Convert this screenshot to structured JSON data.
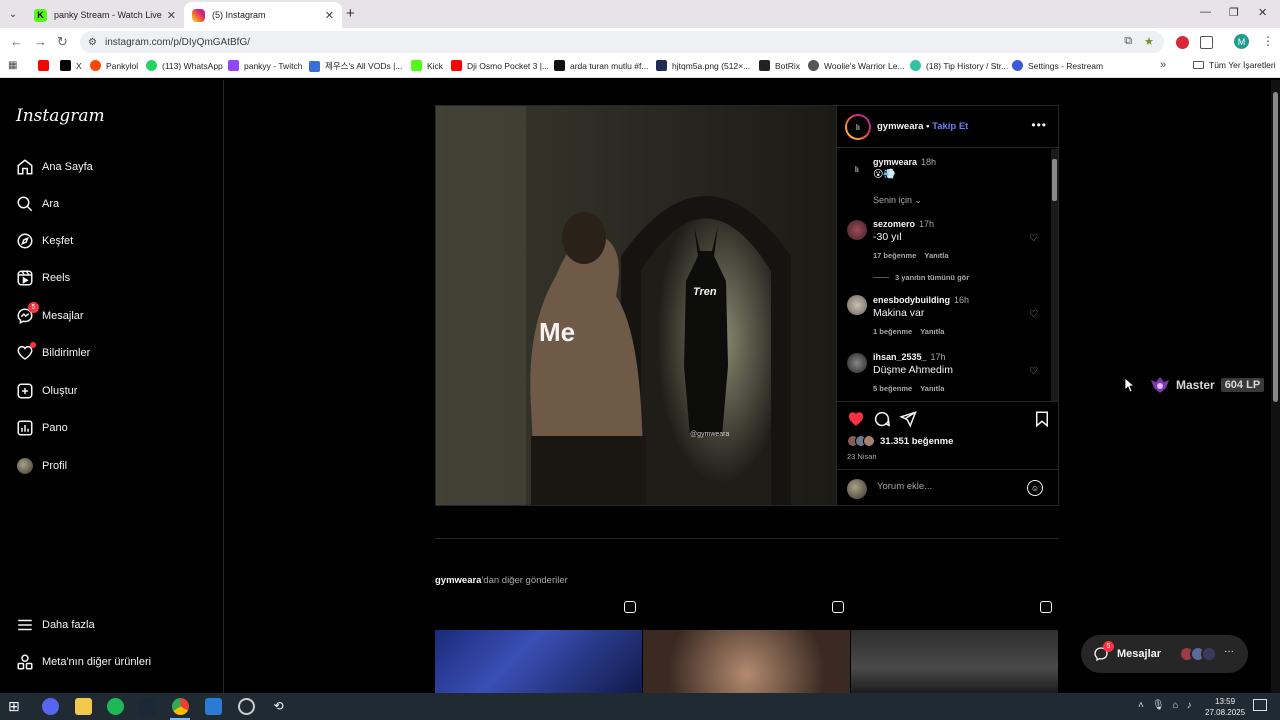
{
  "browser": {
    "tabs": [
      {
        "title": "panky Stream - Watch Live on K",
        "favicon": "kick"
      },
      {
        "title": "(5) Instagram",
        "favicon": "instagram",
        "active": true
      }
    ],
    "url": "instagram.com/p/DIyQmGAtBfG/",
    "profile_initial": "M",
    "bookmarks": [
      "X",
      "Pankylol",
      "(113) WhatsApp",
      "pankyy - Twitch",
      "제우스's All VODs |...",
      "Kick",
      "Dji Osmo Pocket 3 |...",
      "arda turan mutlu #f...",
      "hjtqm5a.png (512×...",
      "BotRix",
      "Woolie's Warrior Le...",
      "(18) Tip History / Str...",
      "Settings - Restream"
    ],
    "all_bookmarks": "Tüm Yer İşaretleri"
  },
  "sidebar": {
    "logo": "Instagram",
    "items": [
      {
        "label": "Ana Sayfa",
        "icon": "home-icon"
      },
      {
        "label": "Ara",
        "icon": "search-icon"
      },
      {
        "label": "Keşfet",
        "icon": "compass-icon"
      },
      {
        "label": "Reels",
        "icon": "reels-icon"
      },
      {
        "label": "Mesajlar",
        "icon": "messenger-icon",
        "badge": "5"
      },
      {
        "label": "Bildirimler",
        "icon": "heart-icon",
        "dot": true
      },
      {
        "label": "Oluştur",
        "icon": "create-icon"
      },
      {
        "label": "Pano",
        "icon": "dashboard-icon"
      },
      {
        "label": "Profil",
        "icon": "avatar"
      }
    ],
    "more": "Daha fazla",
    "meta": "Meta'nın diğer ürünleri"
  },
  "post": {
    "image_text_main": "Me",
    "image_text_figure": "Tren",
    "image_watermark": "@gymweara",
    "author": "gymweara",
    "follow": "Takip Et",
    "caption": {
      "user": "gymweara",
      "time": "18h",
      "text": "😮💨"
    },
    "for_you": "Senin için",
    "comments": [
      {
        "user": "sezomero",
        "time": "17h",
        "text": "-30 yıl",
        "likes": "17 beğenme",
        "reply": "Yanıtla"
      },
      {
        "user": "enesbodybuilding",
        "time": "16h",
        "text": "Makina var",
        "likes": "1 beğenme",
        "reply": "Yanıtla"
      },
      {
        "user": "ihsan_2535_",
        "time": "17h",
        "text": "Düşme Ahmedim",
        "likes": "5 beğenme",
        "reply": "Yanıtla"
      }
    ],
    "view_replies": "3 yanıtın tümünü gör",
    "likes": "31.351 beğenme",
    "date": "23 Nisan",
    "comment_placeholder": "Yorum ekle..."
  },
  "more_posts": {
    "user": "gymweara",
    "suffix": "'dan diğer gönderiler"
  },
  "overlay": {
    "rank": "Master",
    "lp": "604 LP"
  },
  "messages_pill": {
    "label": "Mesajlar",
    "badge": "5"
  },
  "taskbar": {
    "time": "13:59",
    "date": "27.08.2025"
  },
  "colors": {
    "accent": "#0095f6",
    "follow": "#6b7ff5",
    "like": "#ff3040",
    "badge": "#ff3040"
  }
}
